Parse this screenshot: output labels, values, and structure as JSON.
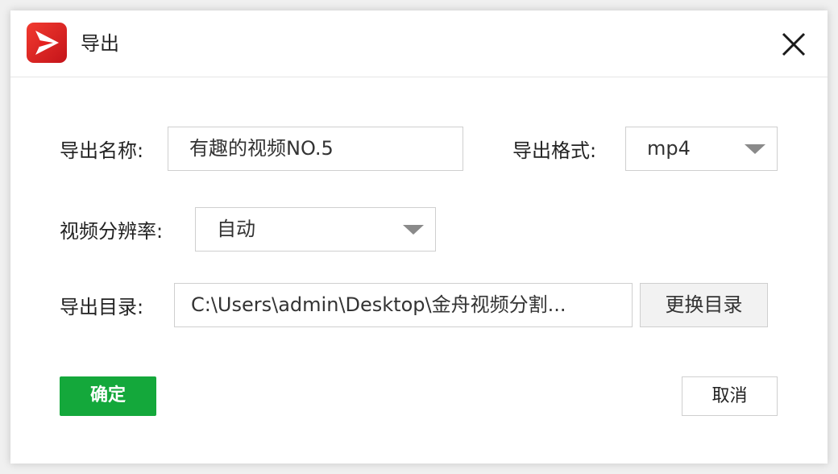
{
  "window": {
    "title": "导出",
    "brand_color": "#e4211f",
    "close_icon": "close-icon"
  },
  "form": {
    "name_label": "导出名称:",
    "name_value": "有趣的视频NO.5",
    "format_label": "导出格式:",
    "format_value": "mp4",
    "resolution_label": "视频分辨率:",
    "resolution_value": "自动",
    "directory_label": "导出目录:",
    "directory_value": "C:\\Users\\admin\\Desktop\\金舟视频分割...",
    "change_directory_label": "更换目录"
  },
  "actions": {
    "confirm_label": "确定",
    "confirm_color": "#14a83b",
    "cancel_label": "取消"
  }
}
